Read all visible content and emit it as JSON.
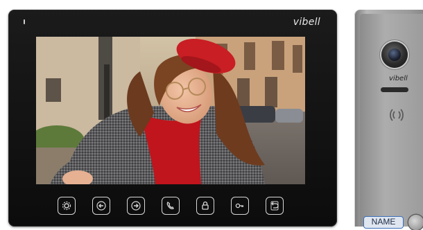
{
  "monitor": {
    "brand": "vibell",
    "photo": {
      "subject": "woman-red-beret",
      "colors": {
        "beret": "#c81e24",
        "sweater": "#c0151c",
        "coat": "#5b5b5d",
        "hair": "#6b3a1f",
        "skin": "#e8b597"
      }
    },
    "buttons": [
      {
        "name": "settings-button",
        "icon": "gear-icon"
      },
      {
        "name": "previous-button",
        "icon": "arrow-left-icon"
      },
      {
        "name": "next-button",
        "icon": "arrow-right-icon"
      },
      {
        "name": "talk-button",
        "icon": "phone-icon"
      },
      {
        "name": "unlock-button",
        "icon": "lock-icon"
      },
      {
        "name": "key-button",
        "icon": "key-icon"
      },
      {
        "name": "back-button",
        "icon": "return-icon"
      }
    ],
    "colors": {
      "bezel": "#141414",
      "button_outline": "#d8d8d8"
    }
  },
  "door_station": {
    "brand": "vibell",
    "name_plate": "NAME",
    "colors": {
      "panel": "#a6a6a6",
      "plate_border": "#3d6fb8"
    }
  }
}
